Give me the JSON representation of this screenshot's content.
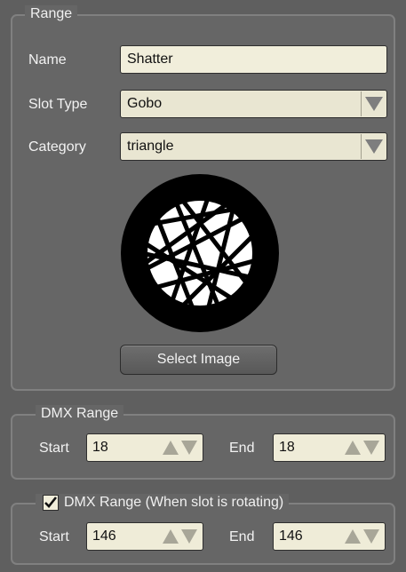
{
  "range": {
    "legend": "Range",
    "name_label": "Name",
    "name_value": "Shatter",
    "slot_type_label": "Slot Type",
    "slot_type_value": "Gobo",
    "category_label": "Category",
    "category_value": "triangle",
    "gobo_image_icon": "shatter-gobo-icon",
    "select_image_label": "Select Image"
  },
  "dmx_range": {
    "legend": "DMX Range",
    "start_label": "Start",
    "start_value": "18",
    "end_label": "End",
    "end_value": "18"
  },
  "dmx_range_rotating": {
    "checked": true,
    "legend": "DMX Range (When slot is rotating)",
    "start_label": "Start",
    "start_value": "146",
    "end_label": "End",
    "end_value": "146"
  },
  "colors": {
    "panel_background": "#666666",
    "window_background": "#5f5f5f",
    "field_background": "#f1eedb"
  }
}
